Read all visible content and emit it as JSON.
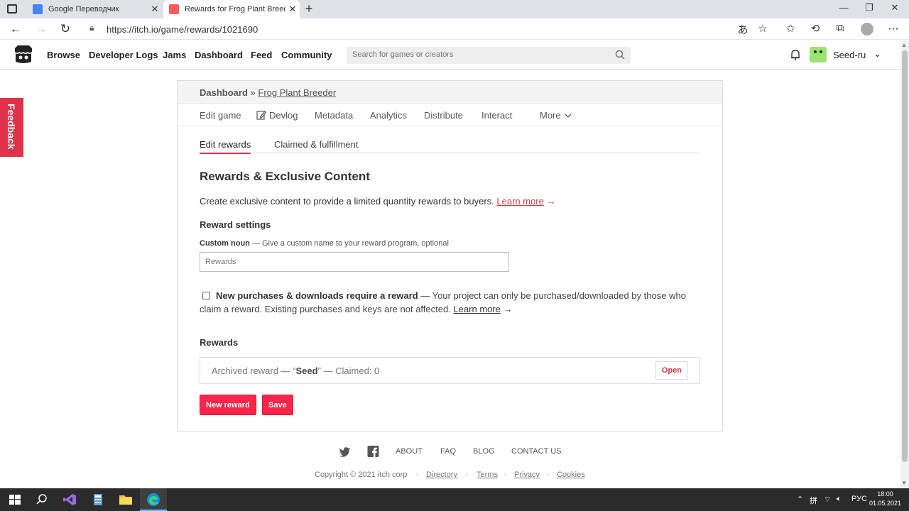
{
  "browser": {
    "tabs": [
      {
        "title": "Google Переводчик",
        "close": "✕"
      },
      {
        "title": "Rewards for Frog Plant Breeder · ",
        "close": "✕"
      }
    ],
    "new_tab": "+",
    "url": "https://itch.io/game/rewards/1021690",
    "window_controls": {
      "minimize": "—",
      "maximize": "❐",
      "close": "✕"
    }
  },
  "header": {
    "nav": [
      "Browse",
      "Developer Logs",
      "Jams",
      "Dashboard",
      "Feed",
      "Community"
    ],
    "search_placeholder": "Search for games or creators",
    "username": "Seed-ru"
  },
  "feedback_label": "Feedback",
  "breadcrumb": {
    "root": "Dashboard",
    "sep": " » ",
    "game": "Frog Plant Breeder"
  },
  "subnav": [
    "Edit game",
    "Devlog",
    "Metadata",
    "Analytics",
    "Distribute",
    "Interact",
    "More"
  ],
  "tabs": {
    "edit_rewards": "Edit rewards",
    "claimed": "Claimed & fulfillment"
  },
  "page": {
    "title": "Rewards & Exclusive Content",
    "description": "Create exclusive content to provide a limited quantity rewards to buyers. ",
    "learn_more": "Learn more",
    "arrow": " →",
    "settings_heading": "Reward settings",
    "custom_noun_label": "Custom noun",
    "custom_noun_hint": " — Give a custom name to your reward program, optional",
    "custom_noun_placeholder": "Rewards",
    "require_label": "New purchases & downloads require a reward",
    "require_text": " — Your project can only be purchased/downloaded by those who claim a reward. Existing purchases and keys are not affected. ",
    "rewards_heading": "Rewards",
    "reward_prefix": "Archived reward — “",
    "reward_name": "Seed",
    "reward_suffix": "” — Claimed: 0",
    "open_button": "Open",
    "new_reward_button": "New reward",
    "save_button": "Save"
  },
  "footer": {
    "links": [
      "ABOUT",
      "FAQ",
      "BLOG",
      "CONTACT US"
    ],
    "copyright": "Copyright © 2021 itch corp",
    "dot": "·",
    "bottom_links": [
      "Directory",
      "Terms",
      "Privacy",
      "Cookies"
    ]
  },
  "taskbar": {
    "lang": "РУС",
    "time": "18:00",
    "date": "01.05.2021"
  },
  "colors": {
    "accent": "#ff2449",
    "feedback": "#e0334b",
    "taskbar": "#2b2b2b"
  }
}
